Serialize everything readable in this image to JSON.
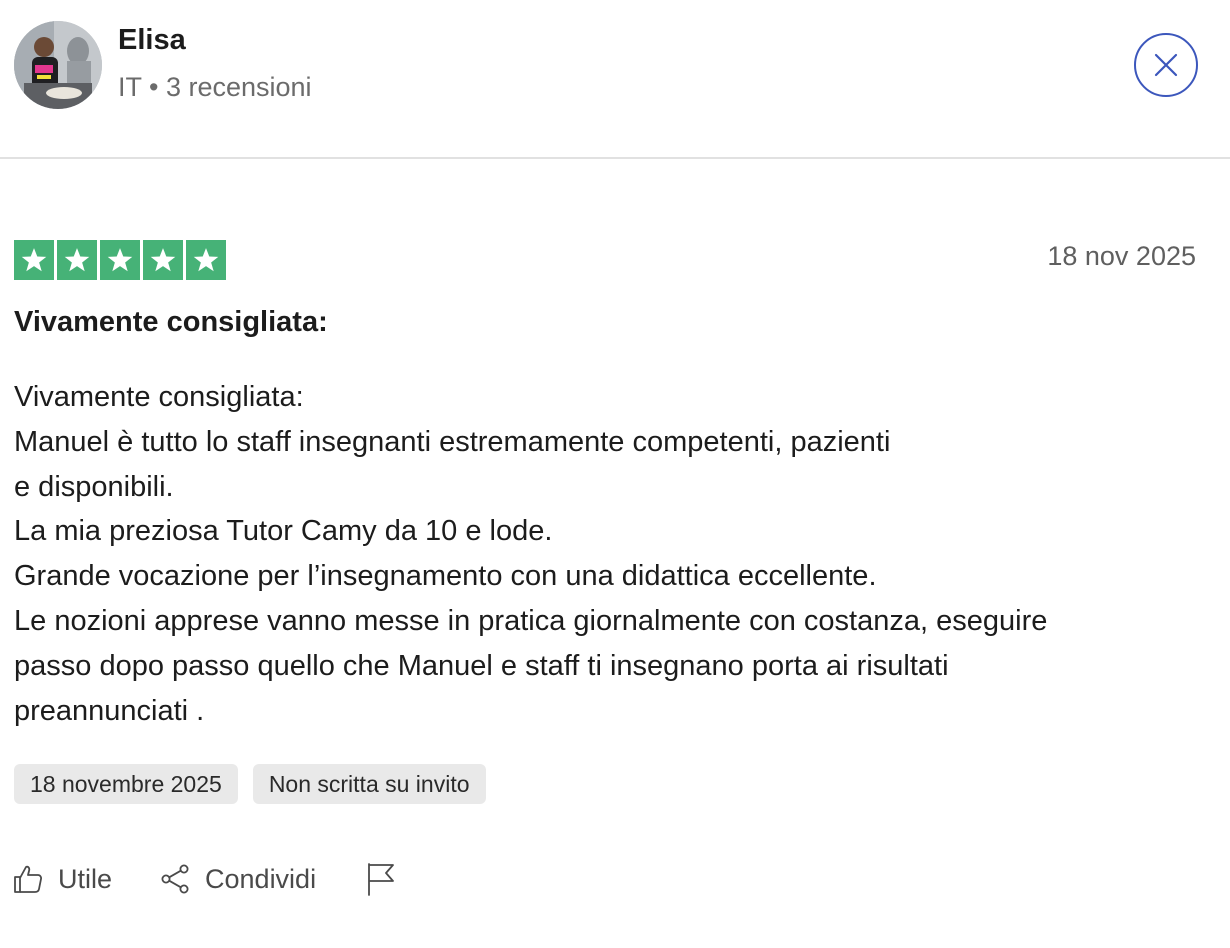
{
  "reviewer": {
    "name": "Elisa",
    "meta": "IT • 3 recensioni"
  },
  "review": {
    "rating": 5,
    "rating_max": 5,
    "star_color": "#46b277",
    "date": "18 nov 2025",
    "title": "Vivamente consigliata:",
    "body_lines": [
      "Vivamente consigliata:",
      "Manuel è tutto lo staff insegnanti estremamente competenti, pazienti",
      "e disponibili.",
      "La mia preziosa Tutor Camy da 10 e lode.",
      "Grande vocazione per l’insegnamento con una didattica eccellente.",
      "Le nozioni apprese vanno messe in pratica giornalmente con costanza, eseguire",
      "passo dopo passo quello che Manuel e staff ti insegnano porta ai risultati",
      "preannunciati ."
    ],
    "tags": [
      "18 novembre 2025",
      "Non scritta su invito"
    ]
  },
  "actions": {
    "useful_label": "Utile",
    "share_label": "Condividi"
  },
  "icons": {
    "close": "close-icon",
    "star": "star-icon",
    "thumbs_up": "thumbs-up-icon",
    "share": "share-icon",
    "flag": "flag-icon"
  },
  "colors": {
    "accent": "#3c57bc",
    "star_bg": "#46b277",
    "tag_bg": "#e9e9e9"
  }
}
